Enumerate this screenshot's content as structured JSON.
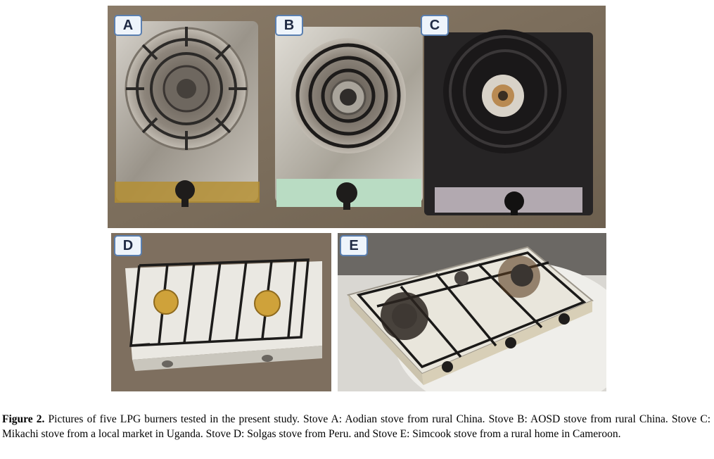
{
  "panels": [
    {
      "id": "A",
      "label": "A"
    },
    {
      "id": "B",
      "label": "B"
    },
    {
      "id": "C",
      "label": "C"
    },
    {
      "id": "D",
      "label": "D"
    },
    {
      "id": "E",
      "label": "E"
    }
  ],
  "caption": {
    "label": "Figure 2.",
    "text": "Pictures of five LPG burners tested in the present study. Stove A: Aodian stove from rural China. Stove B: AOSD stove from rural China. Stove C: Mikachi stove from a local market in Uganda. Stove D: Solgas stove from Peru. and Stove E: Simcook stove from a rural home in Cameroon."
  },
  "colors": {
    "label_border": "#5a7fb0",
    "label_fill": "#eef4fb",
    "floor": "#7d6e5c",
    "steel": "#b9b4ab",
    "black_stove": "#2a2829",
    "enamel_white": "#ecebe6",
    "brass": "#c9962f"
  }
}
